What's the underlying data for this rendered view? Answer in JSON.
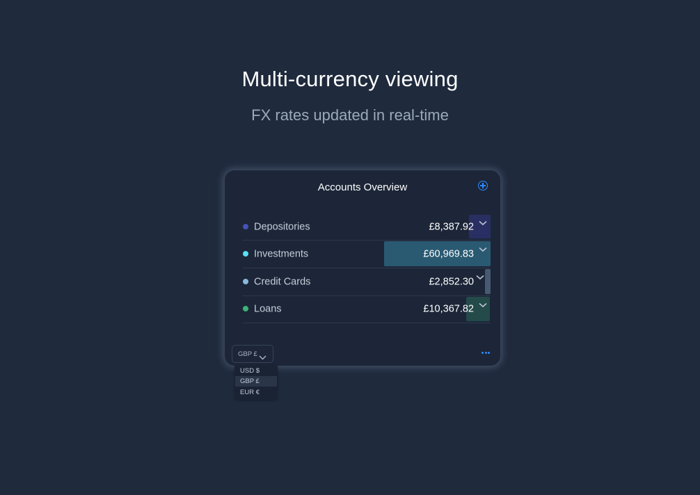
{
  "hero": {
    "title": "Multi-currency viewing",
    "subtitle": "FX rates updated in real-time"
  },
  "card": {
    "title": "Accounts Overview",
    "add_icon": "plus-circle-icon",
    "more_icon": "ellipsis-icon",
    "accounts": [
      {
        "label": "Depositories",
        "amount": "£8,387.92",
        "dot_color": "#4651b8",
        "bar_color": "#2a2f63",
        "share": 0.1025
      },
      {
        "label": "Investments",
        "amount": "£60,969.83",
        "dot_color": "#59e0f5",
        "bar_color": "#2a5a72",
        "share": 0.7453
      },
      {
        "label": "Credit Cards",
        "amount": "£2,852.30",
        "dot_color": "#8ab9d9",
        "bar_color": "#475a72",
        "share": 0.0349
      },
      {
        "label": "Loans",
        "amount": "£10,367.82",
        "dot_color": "#3db378",
        "bar_color": "#244a4a",
        "share": 0.1267
      }
    ]
  },
  "currency": {
    "selected_label": "GBP £",
    "options": [
      "USD $",
      "GBP £",
      "EUR €"
    ],
    "selected_index": 1
  }
}
